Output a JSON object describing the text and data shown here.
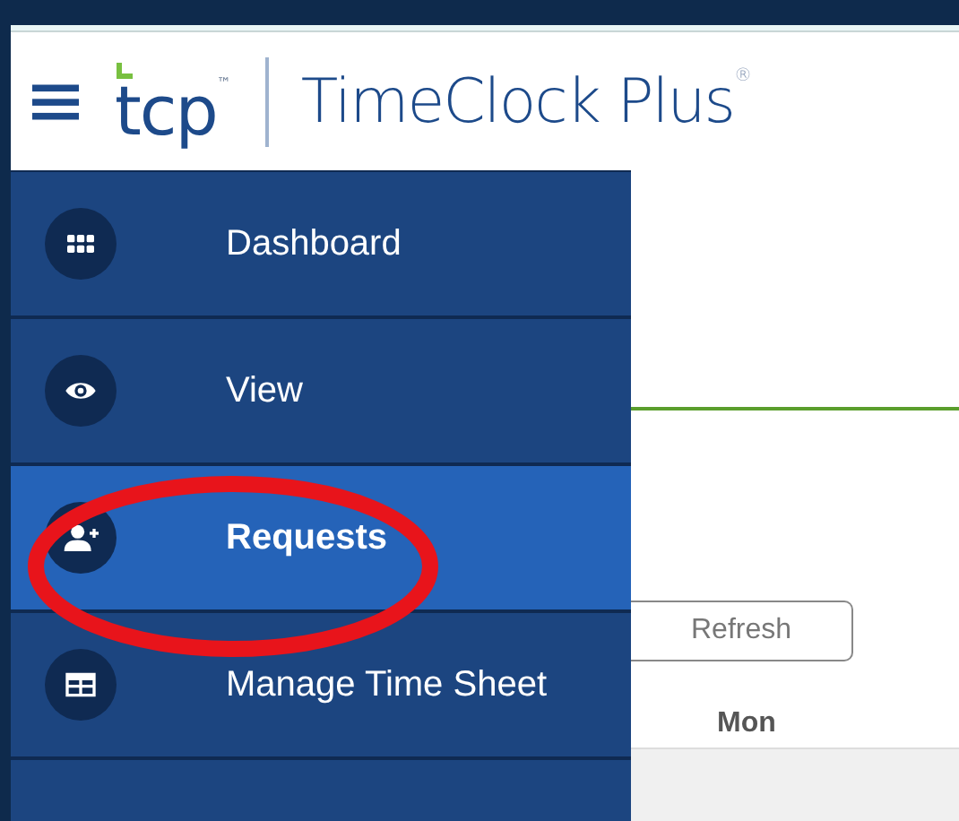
{
  "header": {
    "logo_text": "tcp",
    "logo_mark": "™",
    "product_name": "TimeClock Plus",
    "registered_mark": "®"
  },
  "sidebar": {
    "items": [
      {
        "label": "Dashboard",
        "kind": "grid",
        "selected": false
      },
      {
        "label": "View",
        "kind": "eye",
        "selected": false
      },
      {
        "label": "Requests",
        "kind": "user-plus",
        "selected": true
      },
      {
        "label": "Manage Time Sheet",
        "kind": "table",
        "selected": false
      }
    ]
  },
  "main": {
    "refresh_button": "Refresh",
    "column_header": "Mon"
  },
  "annotation": {
    "kind": "ellipse"
  }
}
